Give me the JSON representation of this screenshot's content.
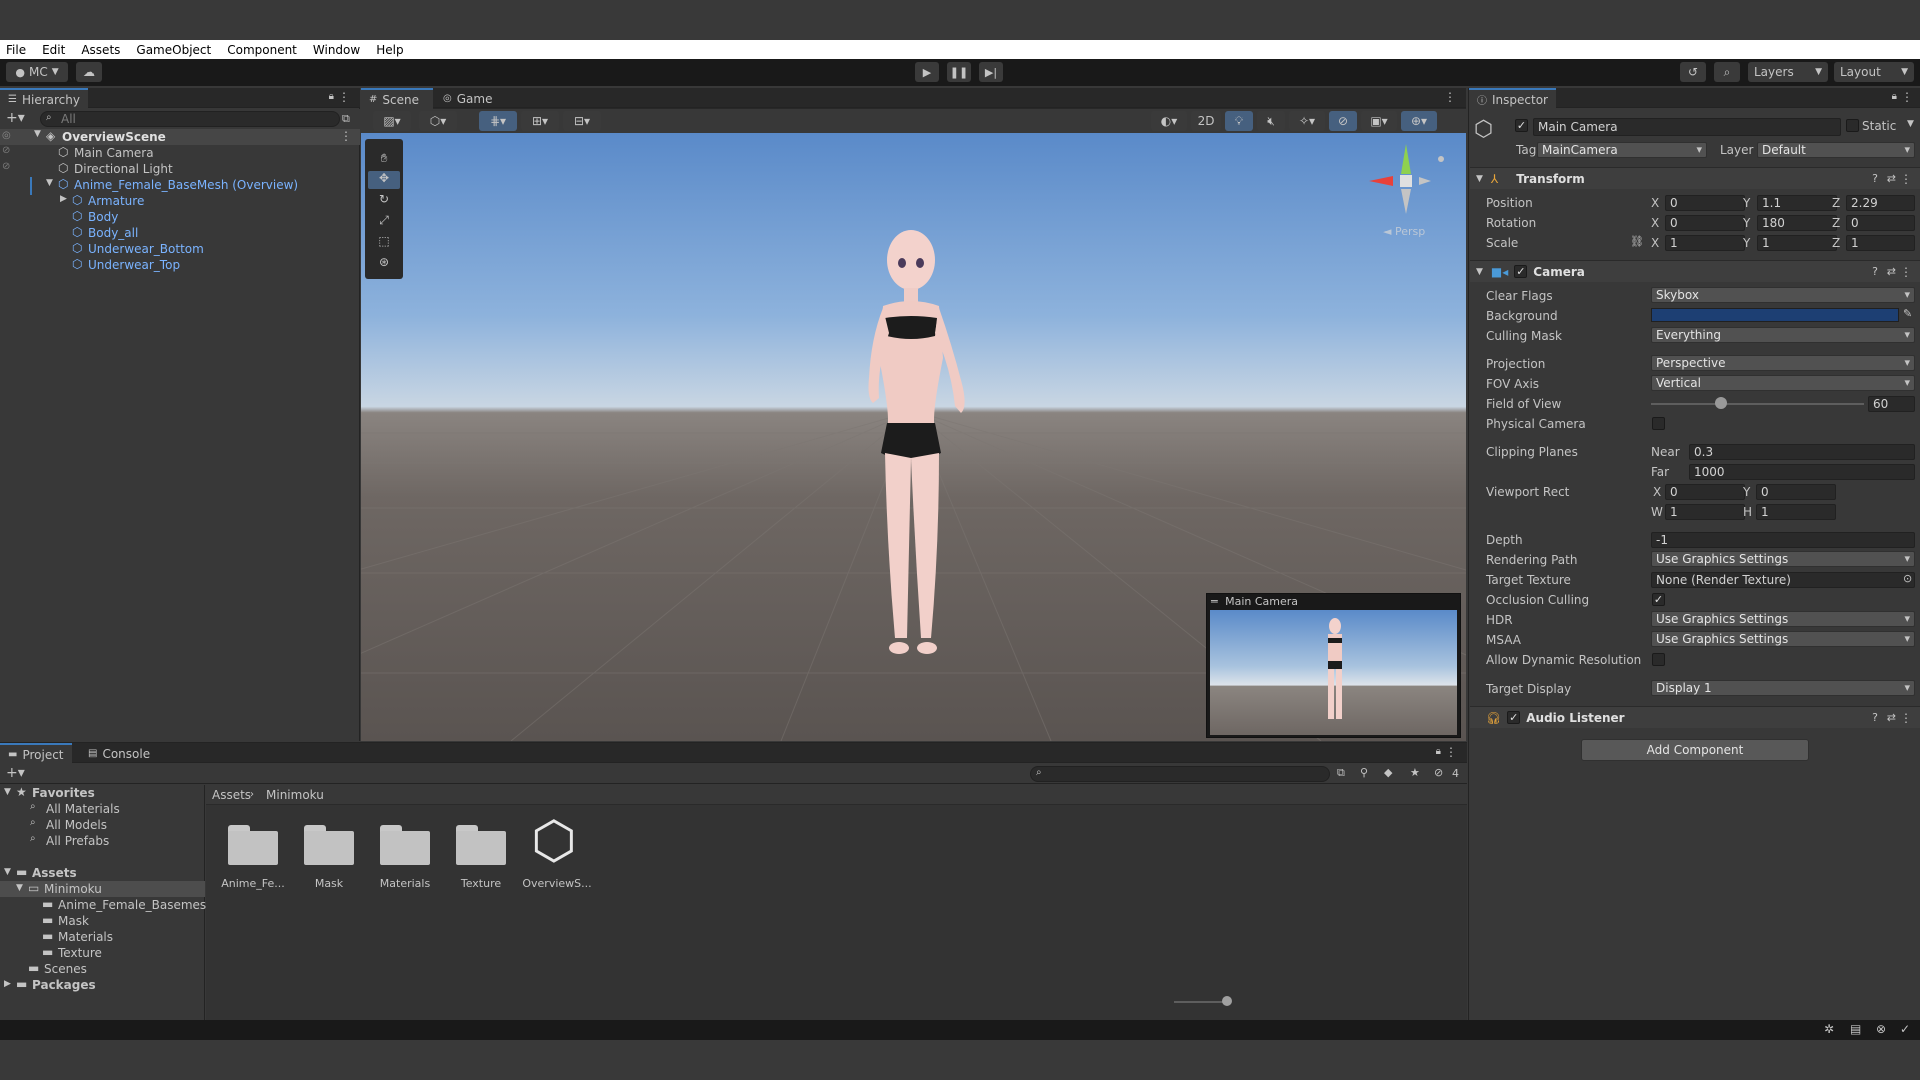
{
  "menu": [
    "File",
    "Edit",
    "Assets",
    "GameObject",
    "Component",
    "Window",
    "Help"
  ],
  "toolbar": {
    "account": "MC",
    "layers": "Layers",
    "layout": "Layout"
  },
  "hierarchy": {
    "tab": "Hierarchy",
    "search_placeholder": "All",
    "scene": "OverviewScene",
    "items": [
      {
        "label": "Main Camera",
        "depth": 1,
        "prefab": false
      },
      {
        "label": "Directional Light",
        "depth": 1,
        "prefab": false
      },
      {
        "label": "Anime_Female_BaseMesh (Overview)",
        "depth": 1,
        "prefab": true
      },
      {
        "label": "Armature",
        "depth": 2,
        "prefab": true
      },
      {
        "label": "Body",
        "depth": 2,
        "prefab": true
      },
      {
        "label": "Body_all",
        "depth": 2,
        "prefab": true
      },
      {
        "label": "Underwear_Bottom",
        "depth": 2,
        "prefab": true
      },
      {
        "label": "Underwear_Top",
        "depth": 2,
        "prefab": true
      }
    ]
  },
  "scene": {
    "tabs": [
      "Scene",
      "Game"
    ],
    "btn_2d": "2D",
    "persp": "◄ Persp",
    "camera_preview_title": "Main Camera"
  },
  "inspector": {
    "tab": "Inspector",
    "object_name": "Main Camera",
    "static_label": "Static",
    "tag_label": "Tag",
    "tag_value": "MainCamera",
    "layer_label": "Layer",
    "layer_value": "Default",
    "transform": {
      "title": "Transform",
      "position_label": "Position",
      "rotation_label": "Rotation",
      "scale_label": "Scale",
      "position": {
        "x": "0",
        "y": "1.1",
        "z": "2.29"
      },
      "rotation": {
        "x": "0",
        "y": "180",
        "z": "0"
      },
      "scale": {
        "x": "1",
        "y": "1",
        "z": "1"
      }
    },
    "camera": {
      "title": "Camera",
      "clear_flags_label": "Clear Flags",
      "clear_flags": "Skybox",
      "background_label": "Background",
      "background_color": "#1d3f73",
      "culling_mask_label": "Culling Mask",
      "culling_mask": "Everything",
      "projection_label": "Projection",
      "projection": "Perspective",
      "fov_axis_label": "FOV Axis",
      "fov_axis": "Vertical",
      "fov_label": "Field of View",
      "fov": "60",
      "fov_fraction": 0.33,
      "physical_label": "Physical Camera",
      "clipping_label": "Clipping Planes",
      "near_label": "Near",
      "near": "0.3",
      "far_label": "Far",
      "far": "1000",
      "viewport_label": "Viewport Rect",
      "vp": {
        "x": "0",
        "y": "0",
        "w": "1",
        "h": "1"
      },
      "depth_label": "Depth",
      "depth": "-1",
      "rendering_path_label": "Rendering Path",
      "rendering_path": "Use Graphics Settings",
      "target_texture_label": "Target Texture",
      "target_texture": "None (Render Texture)",
      "occlusion_label": "Occlusion Culling",
      "hdr_label": "HDR",
      "hdr": "Use Graphics Settings",
      "msaa_label": "MSAA",
      "msaa": "Use Graphics Settings",
      "dynres_label": "Allow Dynamic Resolution",
      "target_display_label": "Target Display",
      "target_display": "Display 1"
    },
    "audio_listener": "Audio Listener",
    "add_component": "Add Component"
  },
  "project": {
    "tabs": [
      "Project",
      "Console"
    ],
    "favorites": "Favorites",
    "fav_items": [
      "All Materials",
      "All Models",
      "All Prefabs"
    ],
    "assets": "Assets",
    "minimoku": "Minimoku",
    "sub_items": [
      "Anime_Female_Basemesh",
      "Mask",
      "Materials",
      "Texture"
    ],
    "scenes": "Scenes",
    "packages": "Packages",
    "breadcrumb": [
      "Assets",
      "Minimoku"
    ],
    "hidden_count": "4",
    "grid_items": [
      "Anime_Fe...",
      "Mask",
      "Materials",
      "Texture",
      "OverviewS..."
    ]
  }
}
